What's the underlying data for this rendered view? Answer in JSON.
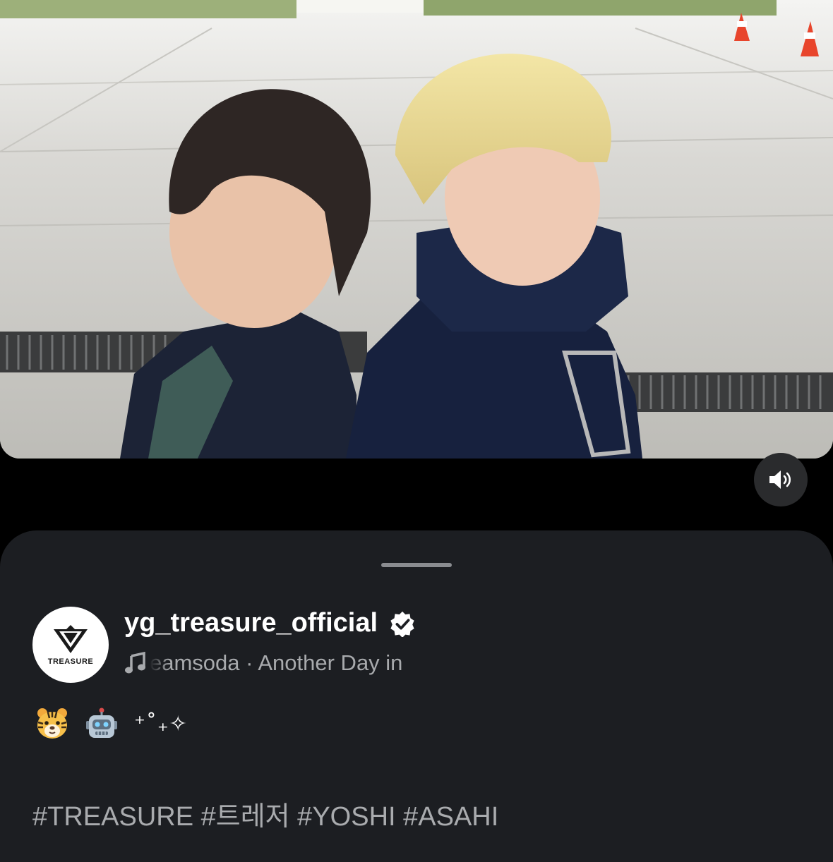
{
  "video": {
    "sound_icon": "speaker-volume-icon"
  },
  "post": {
    "username": "yg_treasure_official",
    "verified_icon": "verified-badge-icon",
    "avatar_label": "TREASURE",
    "audio_icon": "music-note-icon",
    "audio_text": "eamsoda · Another Day in",
    "caption_emojis": [
      "tiger-face",
      "robot-face"
    ],
    "caption_sparkle": "⁺˚₊✧",
    "hashtags": "#TREASURE #트레저 #YOSHI #ASAHI"
  },
  "colors": {
    "sheet_background": "#1c1e22",
    "page_background": "#000000",
    "username": "#ffffff",
    "secondary_text": "#a8aaad",
    "sound_button": "#2a2b2d"
  }
}
